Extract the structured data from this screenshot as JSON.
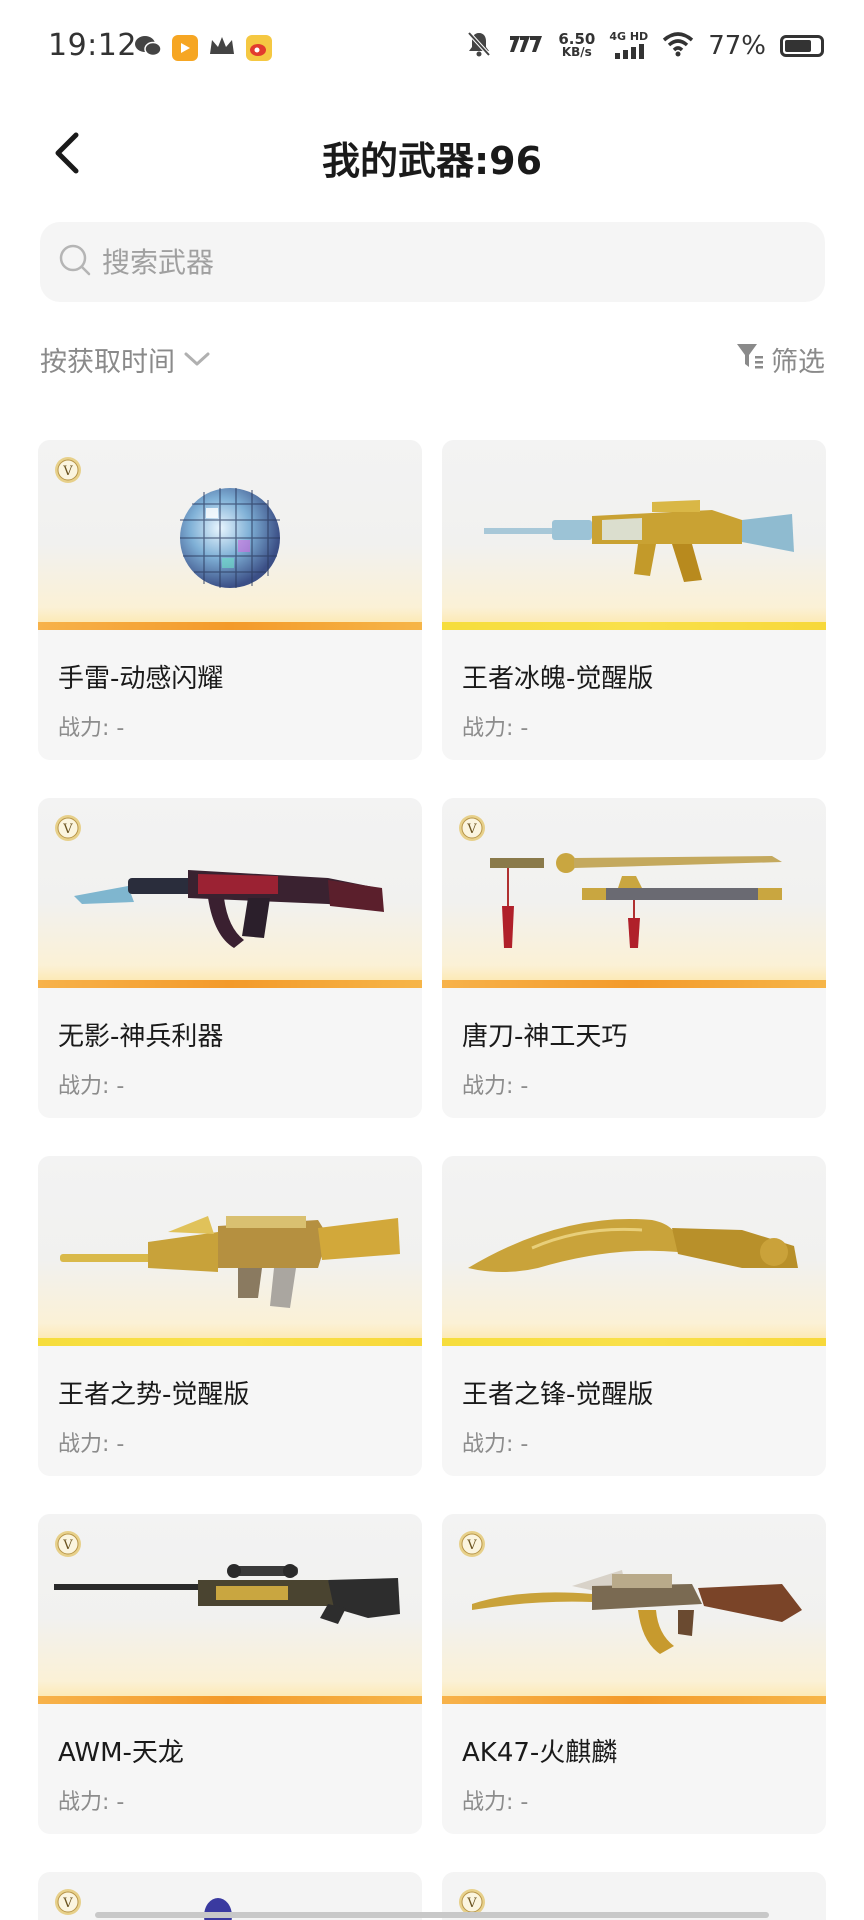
{
  "status_bar": {
    "time": "19:12",
    "net_speed_value": "6.50",
    "net_speed_unit": "KB/s",
    "network_type": "4G HD",
    "battery_pct": "77%",
    "battery_level": 0.77,
    "icons": [
      "wechat-icon",
      "video-app-icon",
      "crown-icon",
      "weibo-icon",
      "mute-icon",
      "app-logo-icon",
      "signal-icon",
      "wifi-icon",
      "battery-icon"
    ]
  },
  "header": {
    "title": "我的武器:96",
    "back_icon": "chevron-left-icon"
  },
  "search": {
    "placeholder": "搜索武器",
    "icon": "search-icon"
  },
  "toolbar": {
    "sort_label": "按获取时间",
    "sort_icon": "chevron-down-icon",
    "filter_label": "筛选",
    "filter_icon": "filter-icon"
  },
  "weapons": [
    {
      "name": "手雷-动感闪耀",
      "power": "战力: -",
      "badge": "V",
      "strip": "orange"
    },
    {
      "name": "王者冰魄-觉醒版",
      "power": "战力: -",
      "badge": "",
      "strip": "yellow"
    },
    {
      "name": "无影-神兵利器",
      "power": "战力: -",
      "badge": "V",
      "strip": "orange"
    },
    {
      "name": "唐刀-神工天巧",
      "power": "战力: -",
      "badge": "V",
      "strip": "orange"
    },
    {
      "name": "王者之势-觉醒版",
      "power": "战力: -",
      "badge": "",
      "strip": "yellow"
    },
    {
      "name": "王者之锋-觉醒版",
      "power": "战力: -",
      "badge": "",
      "strip": "yellow"
    },
    {
      "name": "AWM-天龙",
      "power": "战力: -",
      "badge": "V",
      "strip": "orange"
    },
    {
      "name": "AK47-火麒麟",
      "power": "战力: -",
      "badge": "V",
      "strip": "orange"
    }
  ],
  "partial_badges": [
    "V",
    "V"
  ]
}
